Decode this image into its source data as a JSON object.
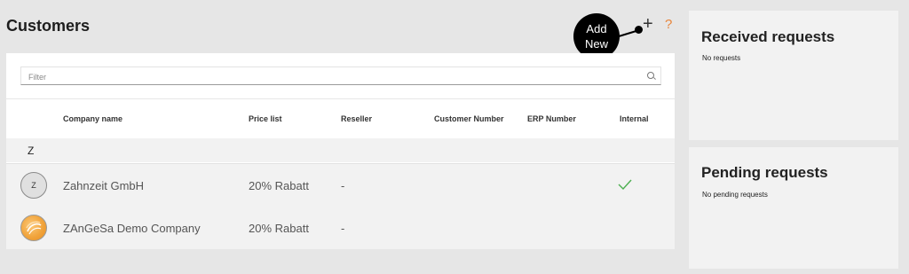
{
  "header": {
    "title": "Customers",
    "add_new_label": "Add\nNew",
    "add_icon": "plus-icon",
    "help_icon": "help-icon",
    "accent_color": "#e8853a"
  },
  "filter": {
    "placeholder": "Filter",
    "value": ""
  },
  "table": {
    "columns": [
      "Company name",
      "Price list",
      "Reseller",
      "Customer Number",
      "ERP Number",
      "Internal"
    ],
    "groups": [
      {
        "letter": "Z",
        "rows": [
          {
            "avatar": "Z",
            "company": "Zahnzeit GmbH",
            "price_list": "20% Rabatt",
            "reseller": "-",
            "customer_number": "",
            "erp_number": "",
            "internal": true
          },
          {
            "avatar": "logo",
            "company": "ZAnGeSa Demo Company",
            "price_list": "20% Rabatt",
            "reseller": "-",
            "customer_number": "",
            "erp_number": "",
            "internal": false
          }
        ]
      }
    ]
  },
  "side": {
    "received": {
      "title": "Received requests",
      "empty": "No requests"
    },
    "pending": {
      "title": "Pending requests",
      "empty": "No pending requests"
    }
  },
  "colors": {
    "check": "#4caf50"
  }
}
